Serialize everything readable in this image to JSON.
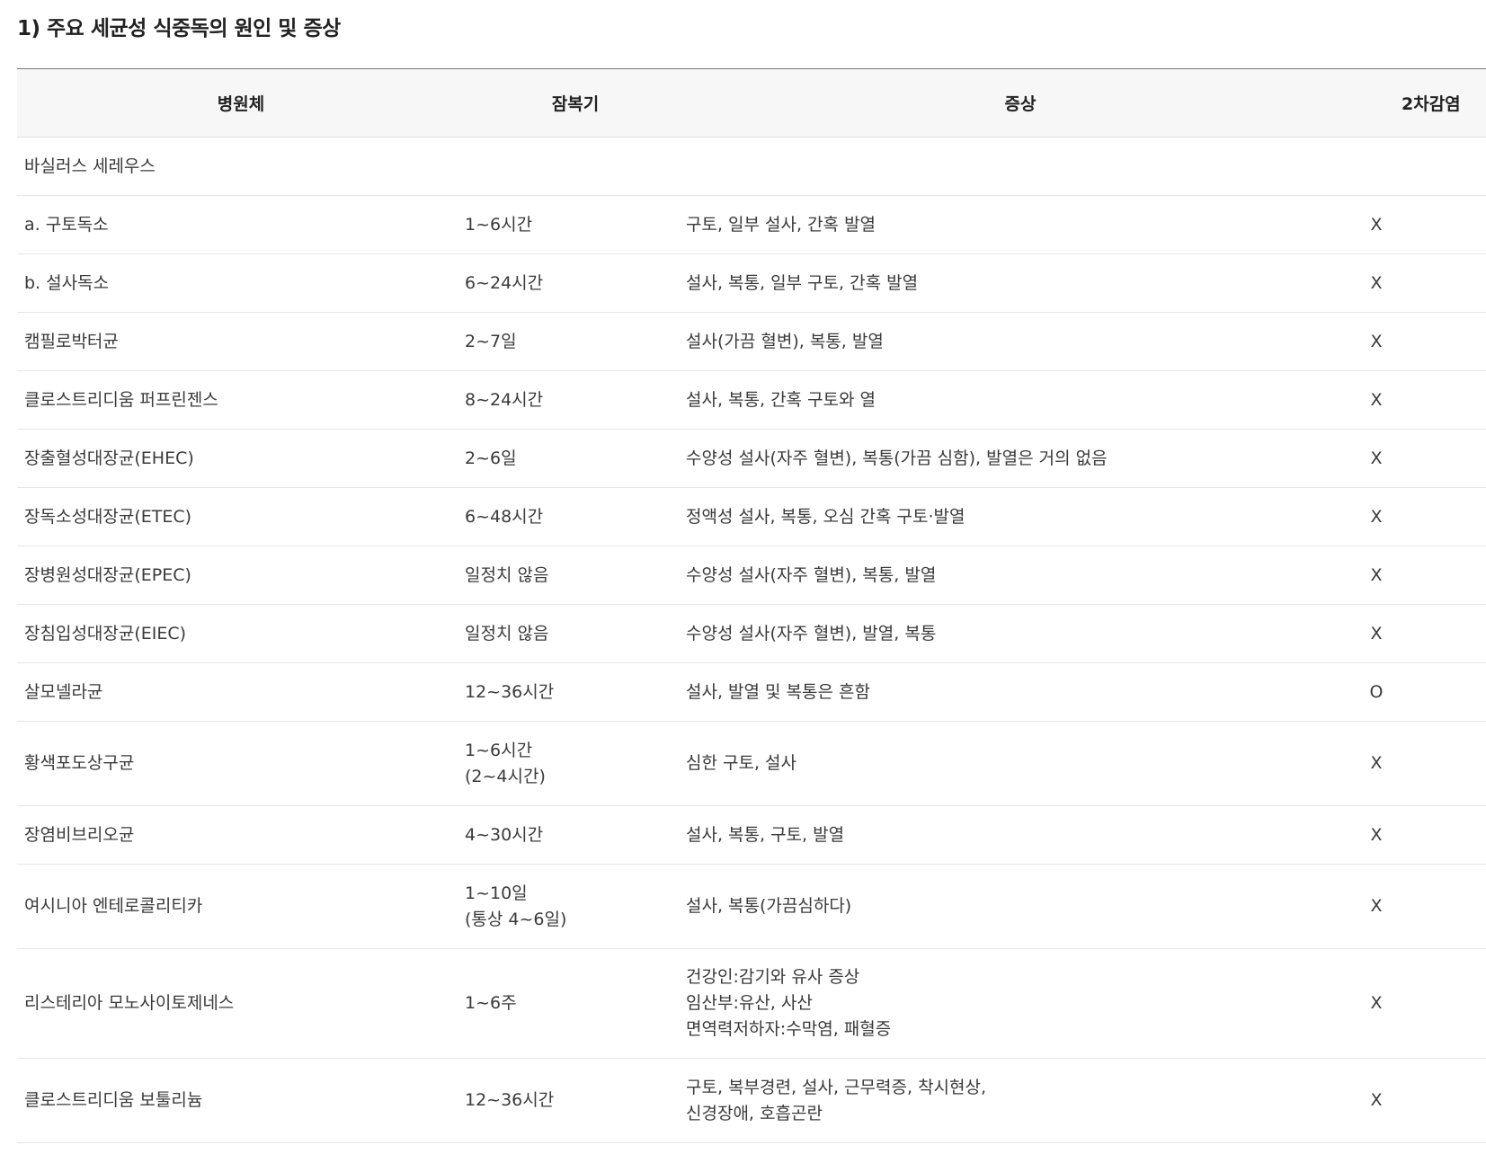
{
  "title": "1) 주요 세균성 식중독의 원인 및 증상",
  "table": {
    "headers": [
      "병원체",
      "잠복기",
      "증상",
      "2차감염"
    ],
    "group_label": "바실러스 세레우스",
    "rows": [
      {
        "pathogen": "a. 구토독소",
        "incubation": [
          "1~6시간"
        ],
        "symptoms": [
          "구토, 일부 설사, 간혹 발열"
        ],
        "secondary": "X"
      },
      {
        "pathogen": "b. 설사독소",
        "incubation": [
          "6~24시간"
        ],
        "symptoms": [
          "설사, 복통, 일부 구토, 간혹 발열"
        ],
        "secondary": "X"
      },
      {
        "pathogen": "캠필로박터균",
        "incubation": [
          "2~7일"
        ],
        "symptoms": [
          "설사(가끔 혈변), 복통, 발열"
        ],
        "secondary": "X"
      },
      {
        "pathogen": "클로스트리디움 퍼프린젠스",
        "incubation": [
          "8~24시간"
        ],
        "symptoms": [
          "설사, 복통, 간혹 구토와 열"
        ],
        "secondary": "X"
      },
      {
        "pathogen": "장출혈성대장균(EHEC)",
        "incubation": [
          "2~6일"
        ],
        "symptoms": [
          "수양성 설사(자주 혈변), 복통(가끔 심함), 발열은 거의 없음"
        ],
        "secondary": "X"
      },
      {
        "pathogen": "장독소성대장균(ETEC)",
        "incubation": [
          "6~48시간"
        ],
        "symptoms": [
          "정액성 설사, 복통, 오심 간혹 구토·발열"
        ],
        "secondary": "X"
      },
      {
        "pathogen": "장병원성대장균(EPEC)",
        "incubation": [
          "일정치 않음"
        ],
        "symptoms": [
          "수양성 설사(자주 혈변), 복통, 발열"
        ],
        "secondary": "X"
      },
      {
        "pathogen": "장침입성대장균(EIEC)",
        "incubation": [
          "일정치 않음"
        ],
        "symptoms": [
          "수양성 설사(자주 혈변), 발열, 복통"
        ],
        "secondary": "X"
      },
      {
        "pathogen": "살모넬라균",
        "incubation": [
          "12~36시간"
        ],
        "symptoms": [
          "설사, 발열 및 복통은 흔함"
        ],
        "secondary": "O"
      },
      {
        "pathogen": "황색포도상구균",
        "incubation": [
          "1~6시간",
          "(2~4시간)"
        ],
        "symptoms": [
          "심한 구토, 설사"
        ],
        "secondary": "X"
      },
      {
        "pathogen": "장염비브리오균",
        "incubation": [
          "4~30시간"
        ],
        "symptoms": [
          "설사, 복통, 구토, 발열"
        ],
        "secondary": "X"
      },
      {
        "pathogen": "여시니아 엔테로콜리티카",
        "incubation": [
          "1~10일",
          "(통상 4~6일)"
        ],
        "symptoms": [
          "설사, 복통(가끔심하다)"
        ],
        "secondary": "X"
      },
      {
        "pathogen": "리스테리아 모노사이토제네스",
        "incubation": [
          "1~6주"
        ],
        "symptoms": [
          "건강인:감기와 유사 증상",
          "임산부:유산, 사산",
          "면역력저하자:수막염, 패혈증"
        ],
        "secondary": "X"
      },
      {
        "pathogen": "클로스트리디움 보툴리늄",
        "incubation": [
          "12~36시간"
        ],
        "symptoms": [
          "구토, 복부경련, 설사, 근무력증, 착시현상,",
          "신경장애, 호흡곤란"
        ],
        "secondary": "X"
      }
    ]
  }
}
